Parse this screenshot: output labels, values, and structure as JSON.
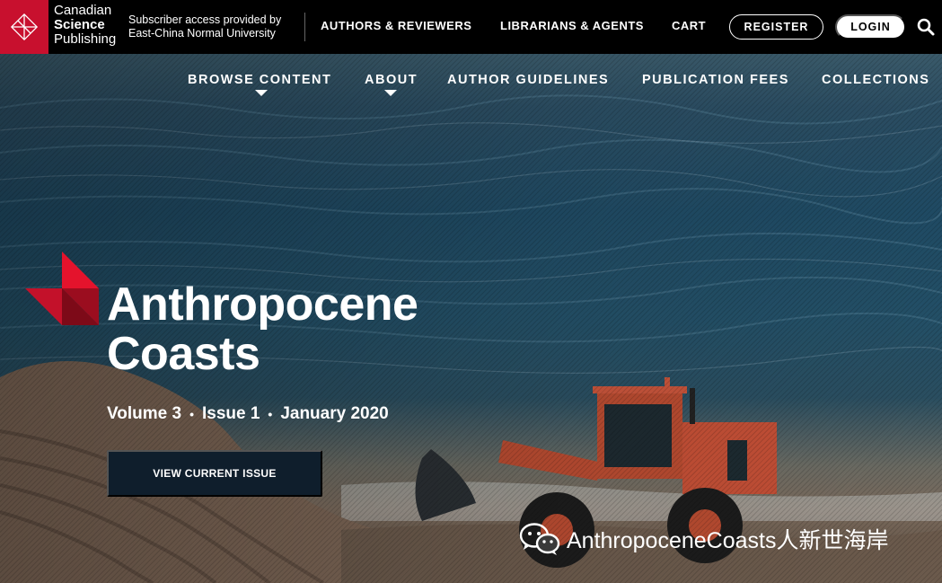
{
  "header": {
    "brand": {
      "line1": "Canadian",
      "line2": "Science",
      "line3": "Publishing"
    },
    "subscriber": {
      "line1": "Subscriber access provided by",
      "line2": "East-China Normal University"
    },
    "nav": [
      {
        "label": "AUTHORS & REVIEWERS"
      },
      {
        "label": "LIBRARIANS & AGENTS"
      },
      {
        "label": "CART"
      }
    ],
    "register_label": "REGISTER",
    "login_label": "LOGIN"
  },
  "subnav": [
    {
      "label": "BROWSE CONTENT"
    },
    {
      "label": "ABOUT"
    },
    {
      "label": "AUTHOR GUIDELINES"
    },
    {
      "label": "PUBLICATION FEES"
    },
    {
      "label": "COLLECTIONS"
    }
  ],
  "hero": {
    "title_line1": "Anthropocene",
    "title_line2": "Coasts",
    "volume": "Volume 3",
    "issue": "Issue 1",
    "date": "January 2020",
    "separator": "•",
    "cta_label": "VIEW CURRENT ISSUE"
  },
  "watermark": {
    "text": "AnthropoceneCoasts人新世海岸"
  },
  "colors": {
    "brand_red": "#c8102e",
    "topbar": "#000000",
    "cta_bg": "#0f1e2c"
  }
}
